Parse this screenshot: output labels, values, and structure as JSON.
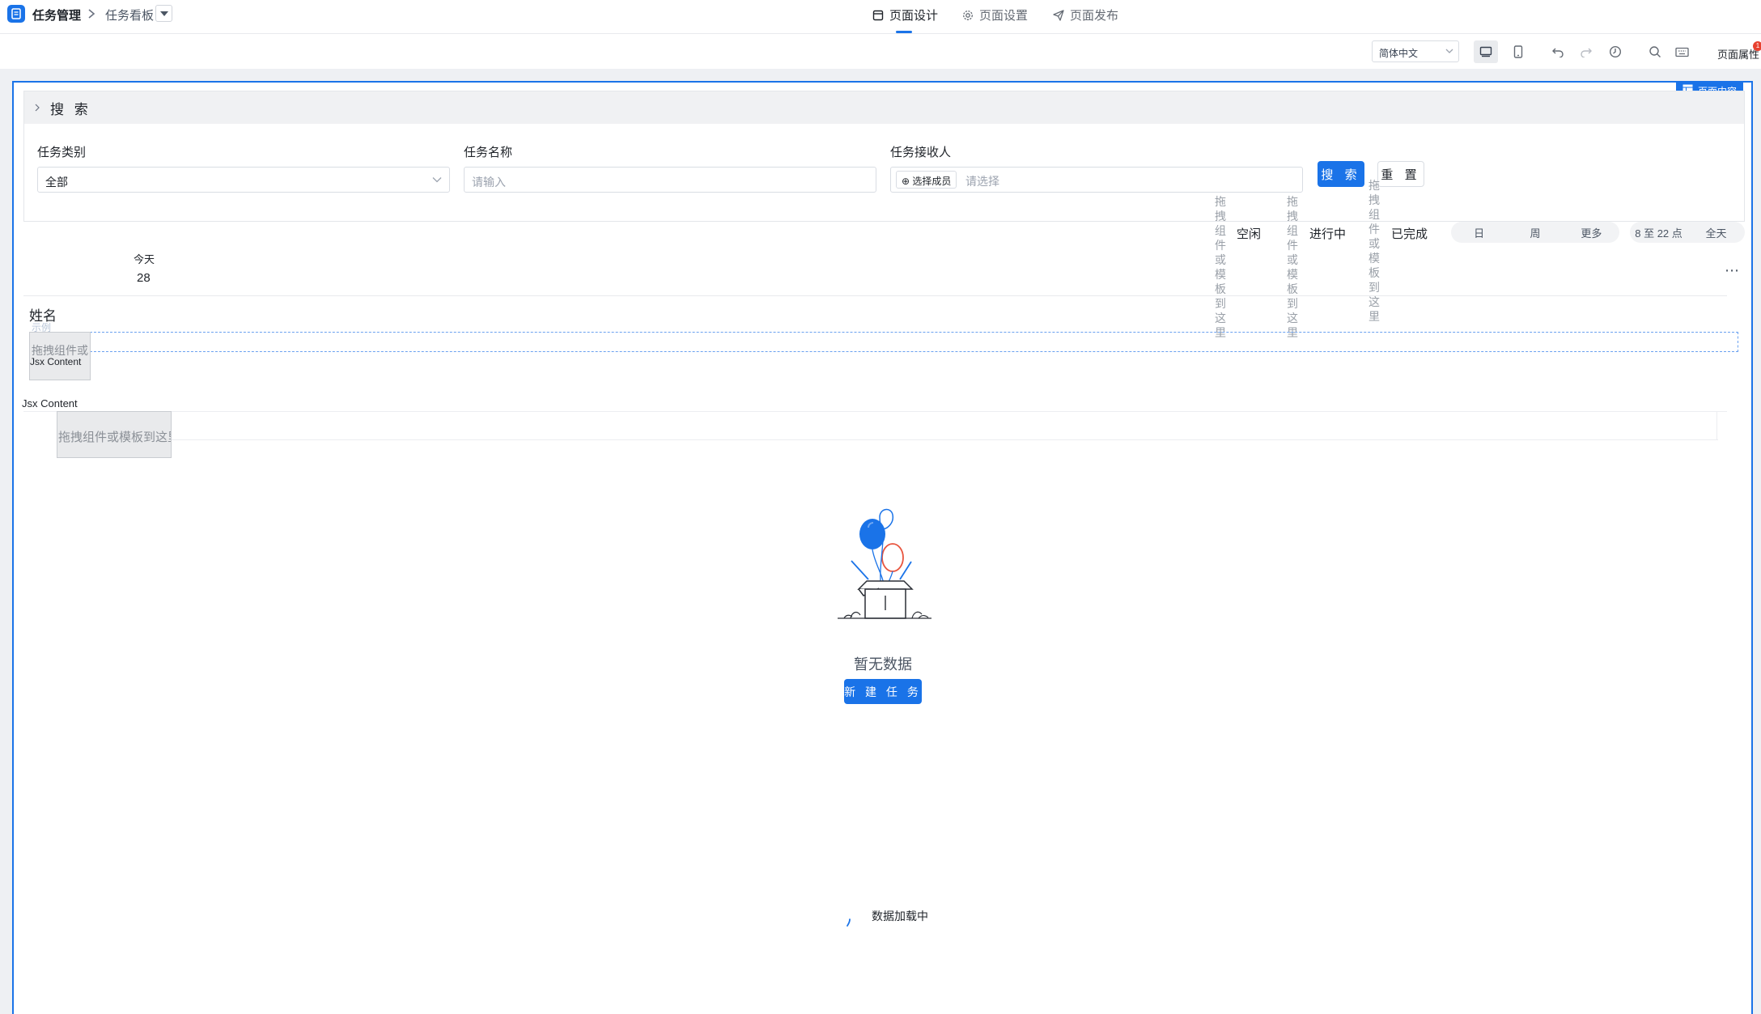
{
  "header": {
    "app_name": "任务管理",
    "breadcrumb_page": "任务看板",
    "tabs": [
      {
        "label": "页面设计",
        "icon": "layout-icon",
        "active": true
      },
      {
        "label": "页面设置",
        "icon": "gear-icon",
        "active": false
      },
      {
        "label": "页面发布",
        "icon": "send-icon",
        "active": false
      }
    ]
  },
  "toolbar": {
    "language": "简体中文",
    "page_attributes": "页面属性",
    "badge": "1"
  },
  "canvas": {
    "page_content_tag": "页面内容",
    "search": {
      "title": "搜 索",
      "fields": {
        "category": {
          "label": "任务类别",
          "value": "全部"
        },
        "name": {
          "label": "任务名称",
          "placeholder": "请输入"
        },
        "assignee": {
          "label": "任务接收人",
          "member_button": "选择成员",
          "placeholder": "请选择"
        }
      },
      "search_button": "搜 索",
      "reset_button": "重 置"
    },
    "drop_hint": "拖拽组件或模板到这里",
    "drop_hint_short": "拖拽组件或",
    "drop_hint_vertical": "拖拽组件或模板到这里",
    "status_filters": [
      "空闲",
      "进行中",
      "已完成"
    ],
    "view_switch": [
      "日",
      "周",
      "更多"
    ],
    "time_switch": [
      "8 至 22 点",
      "全天"
    ],
    "today_label": "今天",
    "today_date": "28",
    "name_label": "姓名",
    "faint_label": "示例",
    "jsx_content": "Jsx Content",
    "empty_text": "暂无数据",
    "new_task_button": "新 建 任 务",
    "loading_text": "数据加载中"
  },
  "colors": {
    "accent": "#1a73e8",
    "canvas_bg": "#eef0f3",
    "balloon_red": "#e8553f"
  }
}
